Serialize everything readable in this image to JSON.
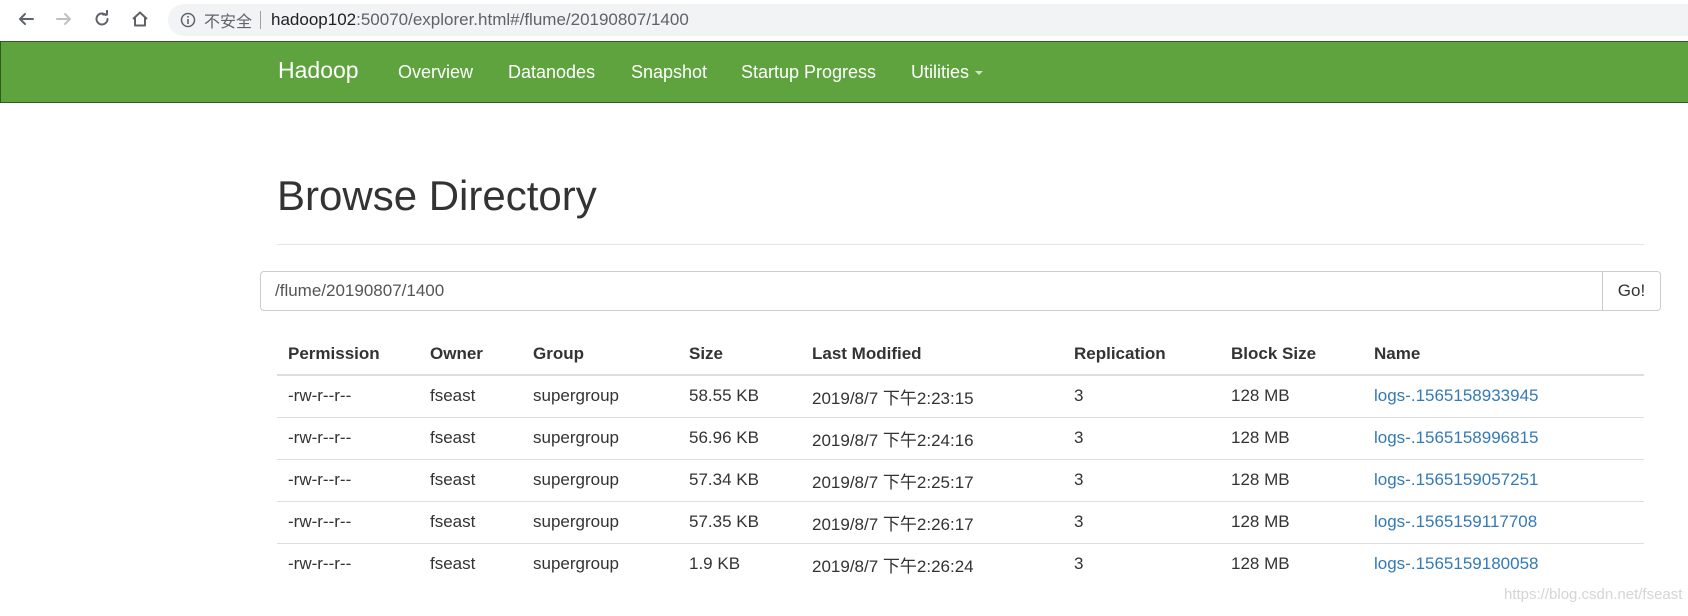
{
  "browser": {
    "security_label": "不安全",
    "url_host": "hadoop102",
    "url_rest": ":50070/explorer.html#/flume/20190807/1400"
  },
  "navbar": {
    "brand": "Hadoop",
    "items": [
      {
        "label": "Overview"
      },
      {
        "label": "Datanodes"
      },
      {
        "label": "Snapshot"
      },
      {
        "label": "Startup Progress"
      },
      {
        "label": "Utilities"
      }
    ],
    "color": "#5fa33e"
  },
  "main": {
    "title": "Browse Directory",
    "path_value": "/flume/20190807/1400",
    "go_label": "Go!"
  },
  "table": {
    "headers": [
      "Permission",
      "Owner",
      "Group",
      "Size",
      "Last Modified",
      "Replication",
      "Block Size",
      "Name"
    ],
    "rows": [
      {
        "permission": "-rw-r--r--",
        "owner": "fseast",
        "group": "supergroup",
        "size": "58.55 KB",
        "modified": "2019/8/7 下午2:23:15",
        "replication": "3",
        "block_size": "128 MB",
        "name": "logs-.1565158933945"
      },
      {
        "permission": "-rw-r--r--",
        "owner": "fseast",
        "group": "supergroup",
        "size": "56.96 KB",
        "modified": "2019/8/7 下午2:24:16",
        "replication": "3",
        "block_size": "128 MB",
        "name": "logs-.1565158996815"
      },
      {
        "permission": "-rw-r--r--",
        "owner": "fseast",
        "group": "supergroup",
        "size": "57.34 KB",
        "modified": "2019/8/7 下午2:25:17",
        "replication": "3",
        "block_size": "128 MB",
        "name": "logs-.1565159057251"
      },
      {
        "permission": "-rw-r--r--",
        "owner": "fseast",
        "group": "supergroup",
        "size": "57.35 KB",
        "modified": "2019/8/7 下午2:26:17",
        "replication": "3",
        "block_size": "128 MB",
        "name": "logs-.1565159117708"
      },
      {
        "permission": "-rw-r--r--",
        "owner": "fseast",
        "group": "supergroup",
        "size": "1.9 KB",
        "modified": "2019/8/7 下午2:26:24",
        "replication": "3",
        "block_size": "128 MB",
        "name": "logs-.1565159180058"
      }
    ],
    "link_color": "#337ab7"
  },
  "watermark": "https://blog.csdn.net/fseast"
}
